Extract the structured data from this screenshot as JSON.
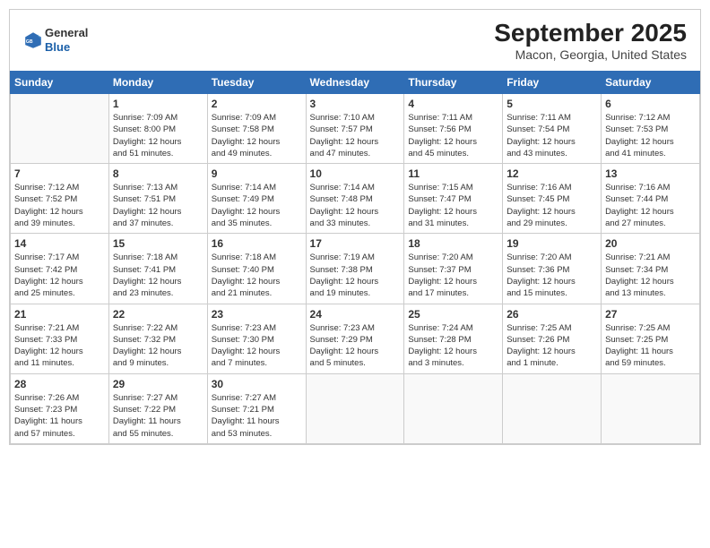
{
  "header": {
    "logo": {
      "line1": "General",
      "line2": "Blue"
    },
    "title": "September 2025",
    "subtitle": "Macon, Georgia, United States"
  },
  "days_of_week": [
    "Sunday",
    "Monday",
    "Tuesday",
    "Wednesday",
    "Thursday",
    "Friday",
    "Saturday"
  ],
  "weeks": [
    [
      {
        "day": "",
        "info": ""
      },
      {
        "day": "1",
        "info": "Sunrise: 7:09 AM\nSunset: 8:00 PM\nDaylight: 12 hours\nand 51 minutes."
      },
      {
        "day": "2",
        "info": "Sunrise: 7:09 AM\nSunset: 7:58 PM\nDaylight: 12 hours\nand 49 minutes."
      },
      {
        "day": "3",
        "info": "Sunrise: 7:10 AM\nSunset: 7:57 PM\nDaylight: 12 hours\nand 47 minutes."
      },
      {
        "day": "4",
        "info": "Sunrise: 7:11 AM\nSunset: 7:56 PM\nDaylight: 12 hours\nand 45 minutes."
      },
      {
        "day": "5",
        "info": "Sunrise: 7:11 AM\nSunset: 7:54 PM\nDaylight: 12 hours\nand 43 minutes."
      },
      {
        "day": "6",
        "info": "Sunrise: 7:12 AM\nSunset: 7:53 PM\nDaylight: 12 hours\nand 41 minutes."
      }
    ],
    [
      {
        "day": "7",
        "info": "Sunrise: 7:12 AM\nSunset: 7:52 PM\nDaylight: 12 hours\nand 39 minutes."
      },
      {
        "day": "8",
        "info": "Sunrise: 7:13 AM\nSunset: 7:51 PM\nDaylight: 12 hours\nand 37 minutes."
      },
      {
        "day": "9",
        "info": "Sunrise: 7:14 AM\nSunset: 7:49 PM\nDaylight: 12 hours\nand 35 minutes."
      },
      {
        "day": "10",
        "info": "Sunrise: 7:14 AM\nSunset: 7:48 PM\nDaylight: 12 hours\nand 33 minutes."
      },
      {
        "day": "11",
        "info": "Sunrise: 7:15 AM\nSunset: 7:47 PM\nDaylight: 12 hours\nand 31 minutes."
      },
      {
        "day": "12",
        "info": "Sunrise: 7:16 AM\nSunset: 7:45 PM\nDaylight: 12 hours\nand 29 minutes."
      },
      {
        "day": "13",
        "info": "Sunrise: 7:16 AM\nSunset: 7:44 PM\nDaylight: 12 hours\nand 27 minutes."
      }
    ],
    [
      {
        "day": "14",
        "info": "Sunrise: 7:17 AM\nSunset: 7:42 PM\nDaylight: 12 hours\nand 25 minutes."
      },
      {
        "day": "15",
        "info": "Sunrise: 7:18 AM\nSunset: 7:41 PM\nDaylight: 12 hours\nand 23 minutes."
      },
      {
        "day": "16",
        "info": "Sunrise: 7:18 AM\nSunset: 7:40 PM\nDaylight: 12 hours\nand 21 minutes."
      },
      {
        "day": "17",
        "info": "Sunrise: 7:19 AM\nSunset: 7:38 PM\nDaylight: 12 hours\nand 19 minutes."
      },
      {
        "day": "18",
        "info": "Sunrise: 7:20 AM\nSunset: 7:37 PM\nDaylight: 12 hours\nand 17 minutes."
      },
      {
        "day": "19",
        "info": "Sunrise: 7:20 AM\nSunset: 7:36 PM\nDaylight: 12 hours\nand 15 minutes."
      },
      {
        "day": "20",
        "info": "Sunrise: 7:21 AM\nSunset: 7:34 PM\nDaylight: 12 hours\nand 13 minutes."
      }
    ],
    [
      {
        "day": "21",
        "info": "Sunrise: 7:21 AM\nSunset: 7:33 PM\nDaylight: 12 hours\nand 11 minutes."
      },
      {
        "day": "22",
        "info": "Sunrise: 7:22 AM\nSunset: 7:32 PM\nDaylight: 12 hours\nand 9 minutes."
      },
      {
        "day": "23",
        "info": "Sunrise: 7:23 AM\nSunset: 7:30 PM\nDaylight: 12 hours\nand 7 minutes."
      },
      {
        "day": "24",
        "info": "Sunrise: 7:23 AM\nSunset: 7:29 PM\nDaylight: 12 hours\nand 5 minutes."
      },
      {
        "day": "25",
        "info": "Sunrise: 7:24 AM\nSunset: 7:28 PM\nDaylight: 12 hours\nand 3 minutes."
      },
      {
        "day": "26",
        "info": "Sunrise: 7:25 AM\nSunset: 7:26 PM\nDaylight: 12 hours\nand 1 minute."
      },
      {
        "day": "27",
        "info": "Sunrise: 7:25 AM\nSunset: 7:25 PM\nDaylight: 11 hours\nand 59 minutes."
      }
    ],
    [
      {
        "day": "28",
        "info": "Sunrise: 7:26 AM\nSunset: 7:23 PM\nDaylight: 11 hours\nand 57 minutes."
      },
      {
        "day": "29",
        "info": "Sunrise: 7:27 AM\nSunset: 7:22 PM\nDaylight: 11 hours\nand 55 minutes."
      },
      {
        "day": "30",
        "info": "Sunrise: 7:27 AM\nSunset: 7:21 PM\nDaylight: 11 hours\nand 53 minutes."
      },
      {
        "day": "",
        "info": ""
      },
      {
        "day": "",
        "info": ""
      },
      {
        "day": "",
        "info": ""
      },
      {
        "day": "",
        "info": ""
      }
    ]
  ]
}
